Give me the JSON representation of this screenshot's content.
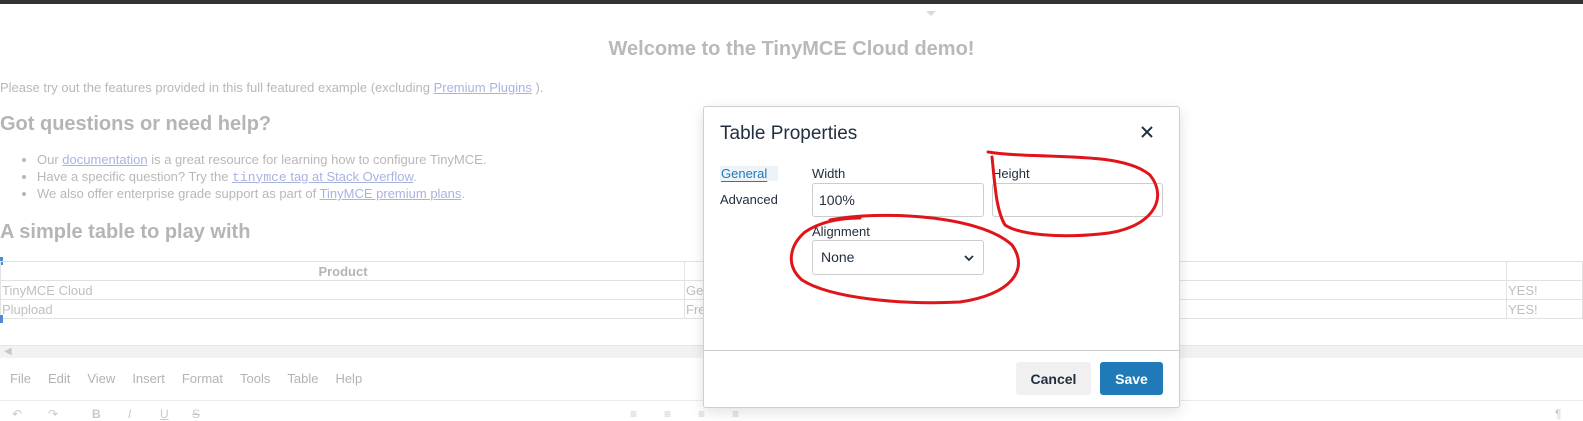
{
  "content": {
    "welcome_heading": "Welcome to the TinyMCE Cloud demo!",
    "intro_text": "Please try out the features provided in this full featured example (excluding ",
    "intro_link": "Premium Plugins",
    "intro_end": " ).",
    "questions_heading": "Got questions or need help?",
    "help_items": [
      {
        "before": "Our ",
        "link": "documentation",
        "after": " is a great resource for learning how to configure TinyMCE."
      },
      {
        "before": "Have a specific question? Try the ",
        "code": "tinymce",
        "link": " tag at Stack Overflow",
        "after": "."
      },
      {
        "before": "We also offer enterprise grade support as part of ",
        "link": "TinyMCE premium plans",
        "after": "."
      }
    ],
    "table_heading": "A simple table to play with",
    "table": {
      "header": "Product",
      "rows": [
        [
          "TinyMCE Cloud",
          "Ge",
          "YES!"
        ],
        [
          "Plupload",
          "Fre",
          "YES!"
        ]
      ]
    }
  },
  "menubar": [
    "File",
    "Edit",
    "View",
    "Insert",
    "Format",
    "Tools",
    "Table",
    "Help"
  ],
  "dialog": {
    "title": "Table Properties",
    "tabs": [
      "General",
      "Advanced"
    ],
    "width_label": "Width",
    "width_value": "100%",
    "height_label": "Height",
    "height_value": "",
    "alignment_label": "Alignment",
    "alignment_value": "None",
    "cancel_label": "Cancel",
    "save_label": "Save"
  },
  "colors": {
    "accent": "#207ab7",
    "annotation": "#e0151a"
  }
}
